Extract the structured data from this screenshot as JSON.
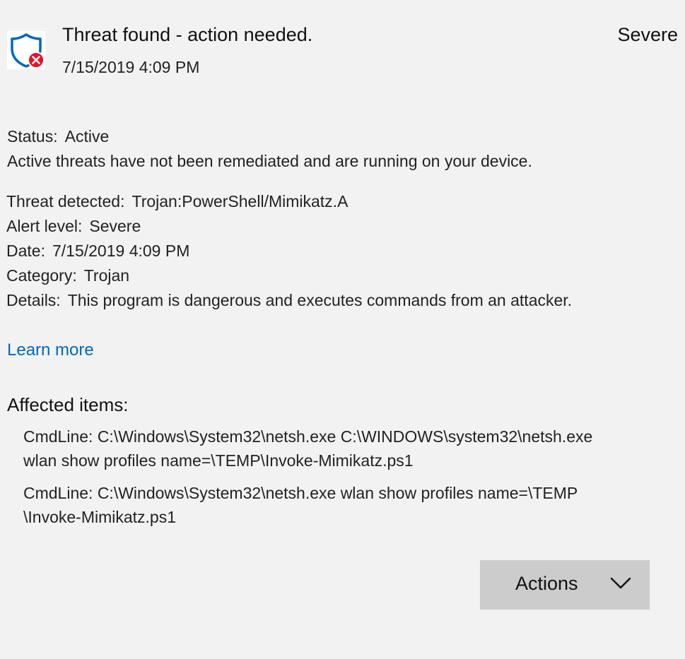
{
  "header": {
    "title": "Threat found - action needed.",
    "timestamp": "7/15/2019 4:09 PM",
    "severity": "Severe",
    "icon": "shield-error-icon"
  },
  "status": {
    "label": "Status:",
    "value": "Active",
    "description": "Active threats have not been remediated and are running on your device."
  },
  "details": [
    {
      "label": "Threat detected:",
      "value": "Trojan:PowerShell/Mimikatz.A"
    },
    {
      "label": "Alert level:",
      "value": "Severe"
    },
    {
      "label": "Date:",
      "value": "7/15/2019 4:09 PM"
    },
    {
      "label": "Category:",
      "value": "Trojan"
    },
    {
      "label": "Details:",
      "value": "This program is dangerous and executes commands from an attacker."
    }
  ],
  "learn_more": "Learn more",
  "affected": {
    "title": "Affected items:",
    "items": [
      "CmdLine: C:\\Windows\\System32\\netsh.exe C:\\WINDOWS\\system32\\netsh.exe\nwlan show profiles name=\\TEMP\\Invoke-Mimikatz.ps1",
      "CmdLine: C:\\Windows\\System32\\netsh.exe wlan show profiles name=\\TEMP\n\\Invoke-Mimikatz.ps1"
    ]
  },
  "actions": {
    "label": "Actions",
    "icon": "chevron-down-icon"
  },
  "colors": {
    "background": "#f2f2f2",
    "link": "#0067c0",
    "shield": "#0067c0",
    "error": "#e81123",
    "button": "#cccccc"
  }
}
